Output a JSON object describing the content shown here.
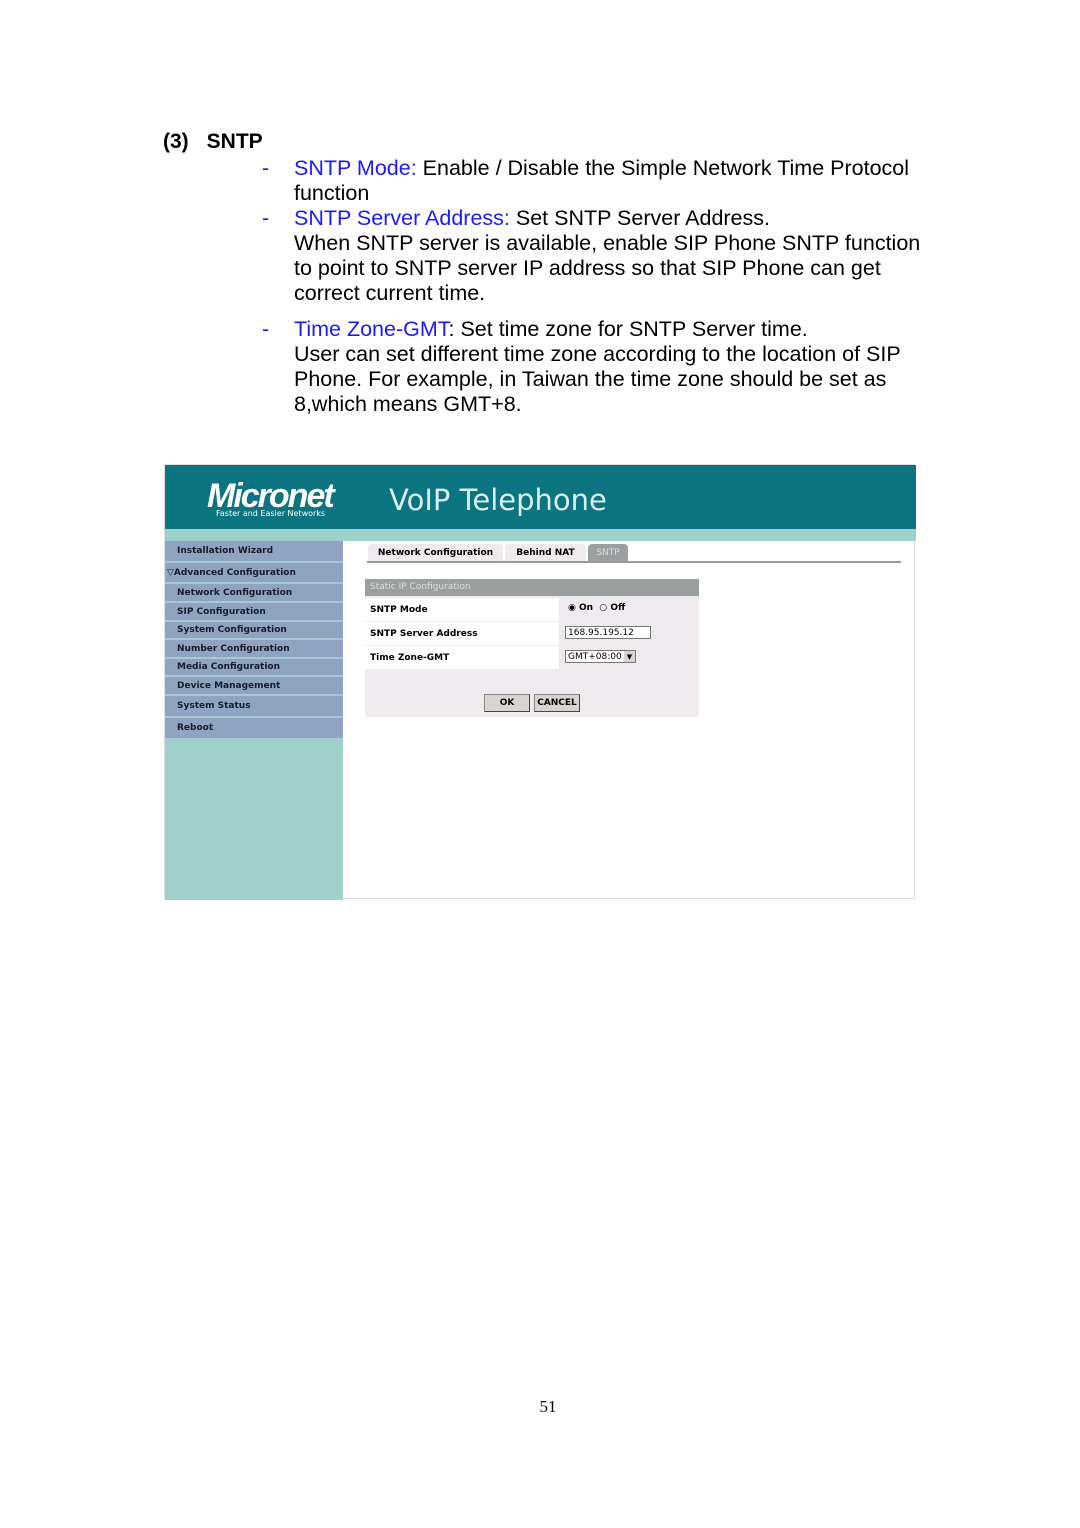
{
  "heading": {
    "number": "(3)",
    "title": "SNTP"
  },
  "bullets": [
    {
      "term": "SNTP Mode:",
      "text": " Enable / Disable the Simple Network Time Protocol function"
    },
    {
      "term": "SNTP Server Address:",
      "text": " Set SNTP Server Address.",
      "extra": "When SNTP server is available, enable SIP Phone SNTP function to point to SNTP server IP address so that SIP Phone can get correct current time."
    },
    {
      "term": "Time Zone-GMT",
      "text": ": Set time zone for SNTP Server time.",
      "extra": "User can set different time zone according to the location of SIP Phone. For example, in Taiwan the time zone should be set as 8,which means GMT+8."
    }
  ],
  "screenshot": {
    "logo": "Micronet",
    "tagline": "Faster and Easier Networks",
    "title": "VoIP Telephone",
    "sidebar": [
      "Installation Wizard",
      "Advanced Configuration",
      "Network Configuration",
      "SIP Configuration",
      "System Configuration",
      "Number Configuration",
      "Media Configuration",
      "Device Management",
      "System Status",
      "Reboot"
    ],
    "tabs": [
      "Network Configuration",
      "Behind NAT",
      "SNTP"
    ],
    "active_tab": "SNTP",
    "panel_title": "Static IP Configuration",
    "rows": {
      "mode_label": "SNTP Mode",
      "on": "On",
      "off": "Off",
      "mode_value": "On",
      "server_label": "SNTP Server Address",
      "server_value": "168.95.195.12",
      "tz_label": "Time Zone-GMT",
      "tz_value": "GMT+08:00"
    },
    "ok": "OK",
    "cancel": "CANCEL",
    "colors": {
      "header": "#0a7480",
      "sidebar": "#8ea4c1",
      "band": "#9fd0cc"
    }
  },
  "page_number": "51"
}
